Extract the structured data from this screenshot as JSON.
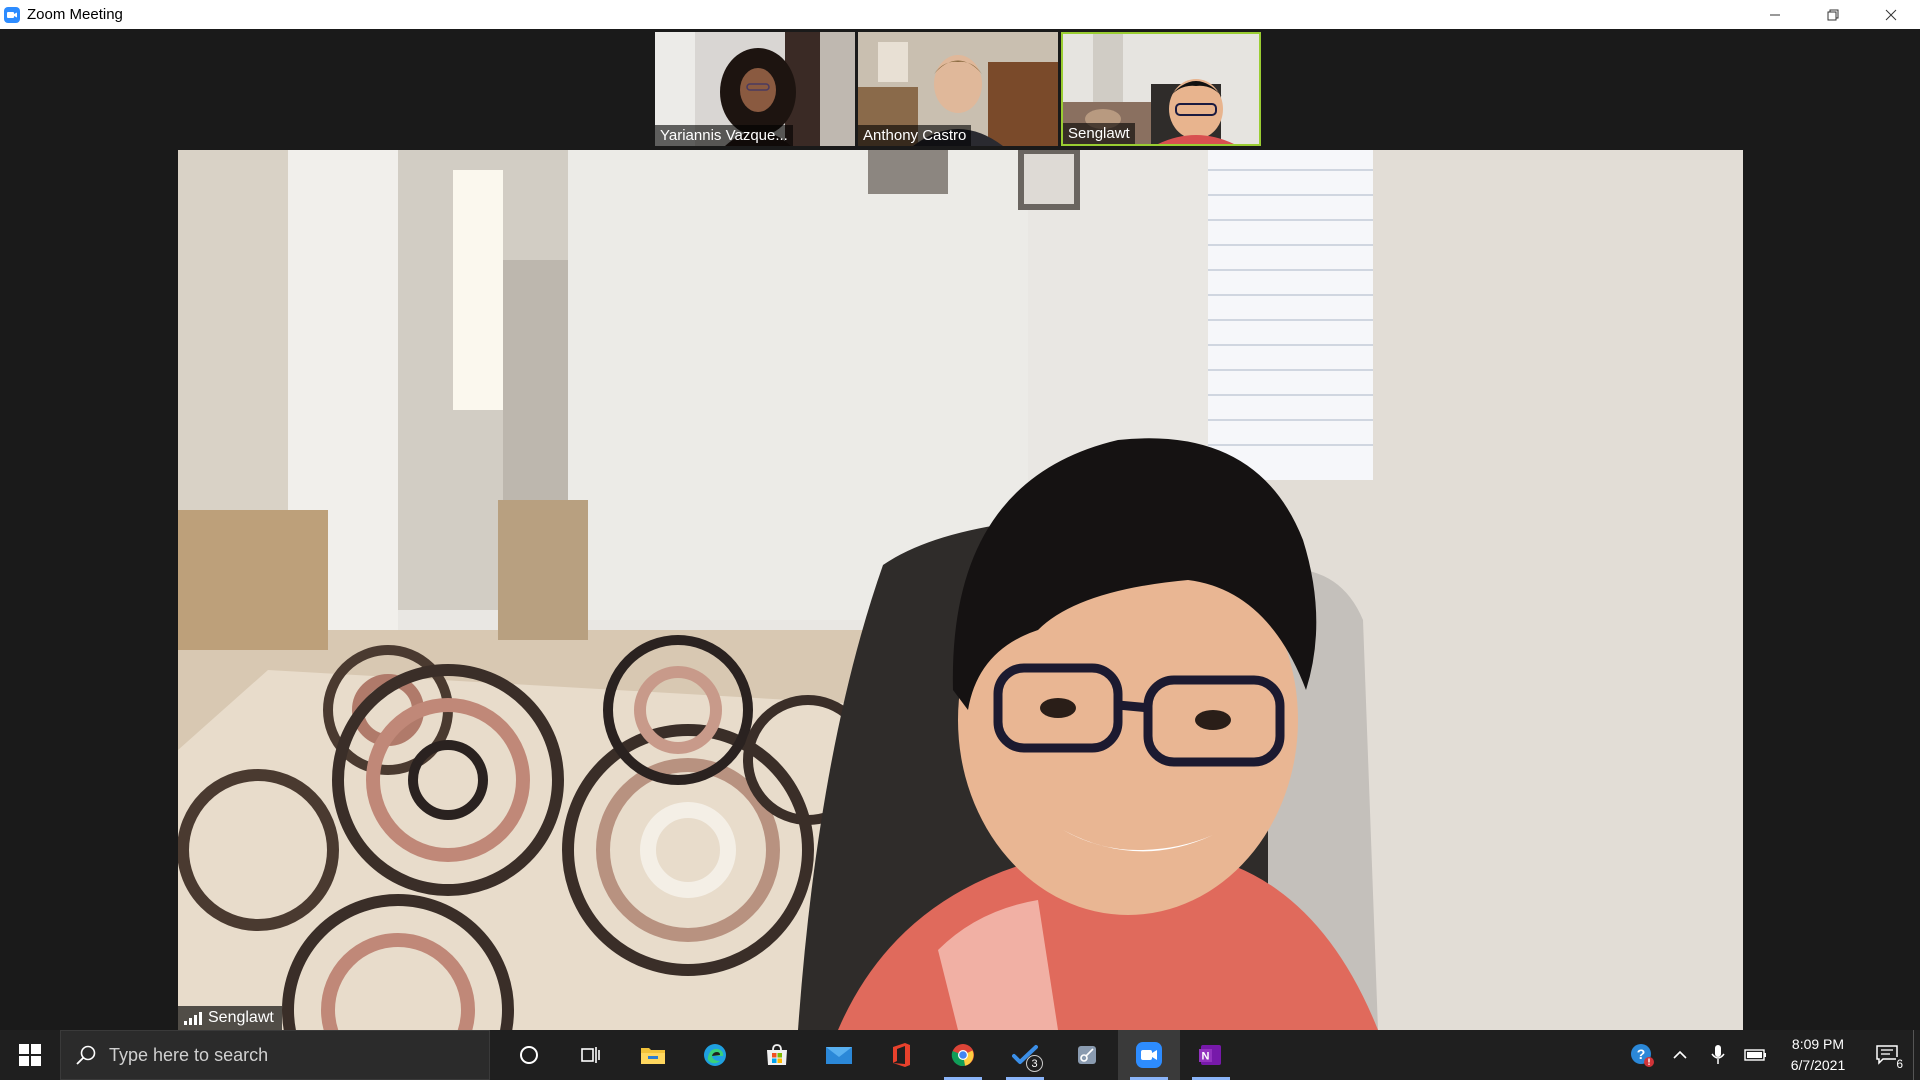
{
  "window": {
    "title": "Zoom Meeting",
    "app_icon": "zoom-camera-icon",
    "controls": [
      "minimize-icon",
      "restore-icon",
      "close-icon"
    ]
  },
  "meeting": {
    "participants": [
      {
        "name": "Yariannis Vazque...",
        "active": false
      },
      {
        "name": "Anthony Castro",
        "active": false
      },
      {
        "name": "Senglawt",
        "active": true
      }
    ],
    "main_speaker": {
      "name": "Senglawt",
      "icon": "signal-strength-icon"
    },
    "accent_color": "#9acd32"
  },
  "taskbar": {
    "search_placeholder": "Type here to search",
    "apps": [
      {
        "name": "cortana-icon"
      },
      {
        "name": "task-view-icon"
      },
      {
        "name": "file-explorer-icon"
      },
      {
        "name": "edge-icon"
      },
      {
        "name": "microsoft-store-icon"
      },
      {
        "name": "mail-icon"
      },
      {
        "name": "office-icon"
      },
      {
        "name": "chrome-icon"
      },
      {
        "name": "todo-icon",
        "badge": "3"
      },
      {
        "name": "snip-tool-icon"
      },
      {
        "name": "zoom-icon"
      },
      {
        "name": "onenote-icon"
      }
    ],
    "tray": {
      "time": "8:09 PM",
      "date": "6/7/2021",
      "notifications_count": "6"
    }
  }
}
